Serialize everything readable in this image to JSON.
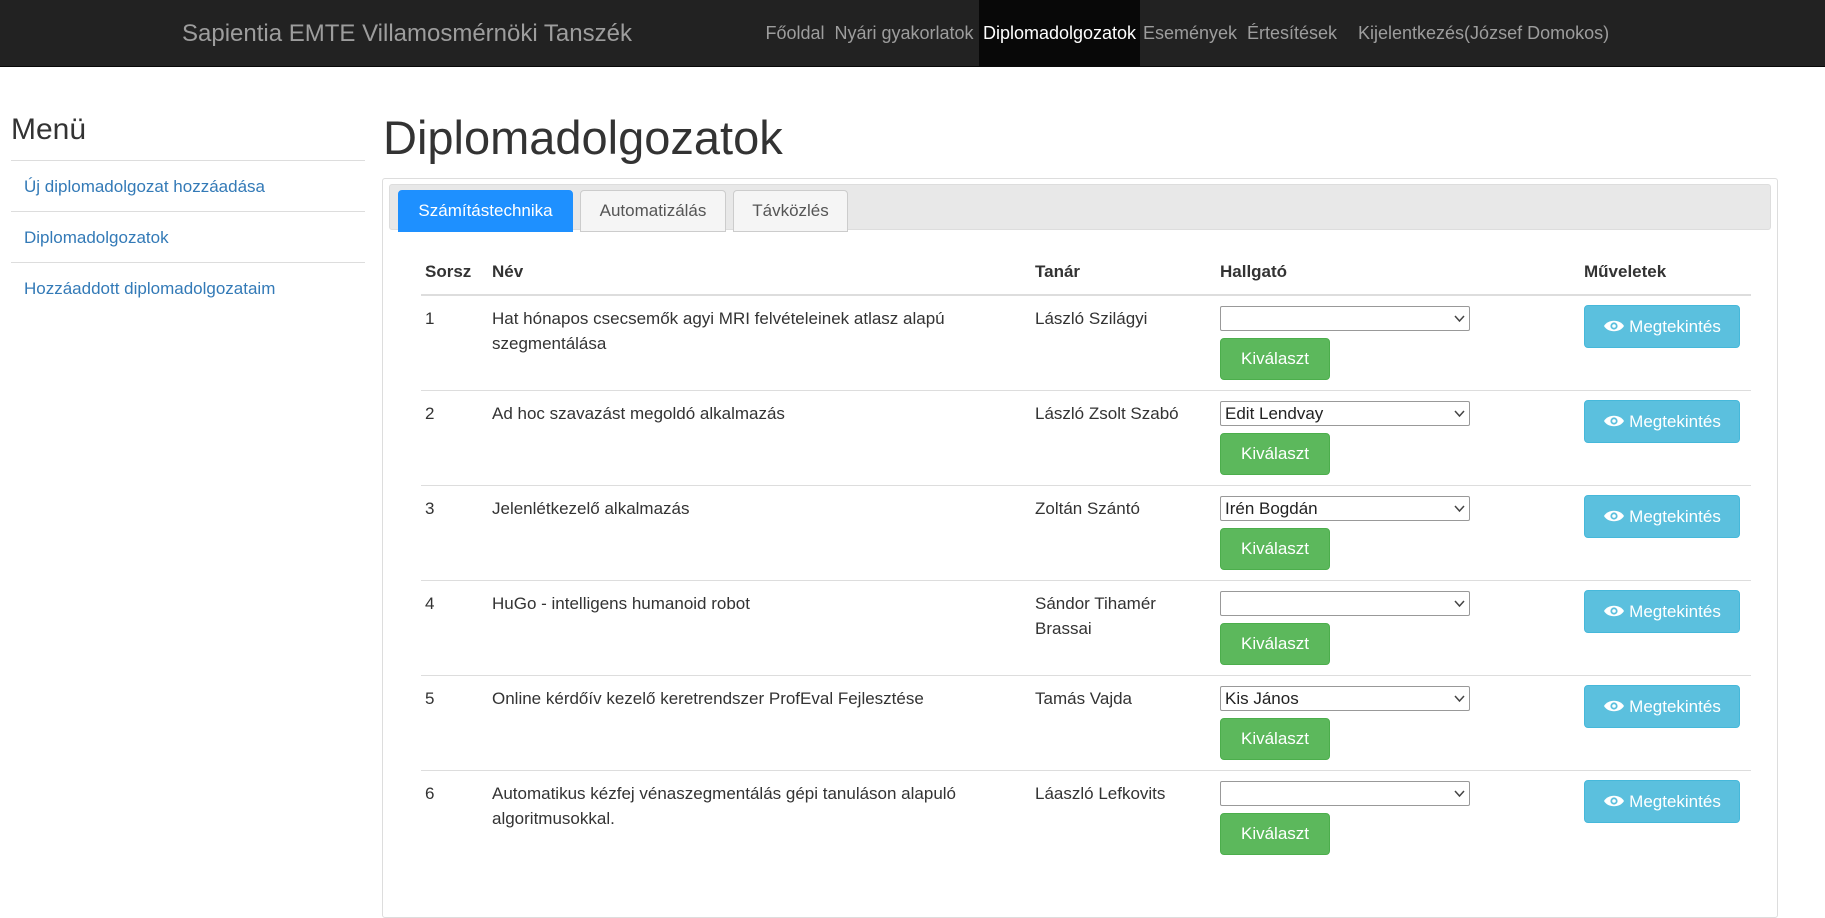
{
  "navbar": {
    "brand": "Sapientia EMTE Villamosmérnöki Tanszék",
    "items": [
      "Főoldal",
      "Nyári gyakorlatok",
      "Diplomadolgozatok",
      "Események",
      "Értesítések",
      "Kijelentkezés(József Domokos)"
    ],
    "active": "Diplomadolgozatok"
  },
  "sidebar": {
    "title": "Menü",
    "items": [
      "Új diplomadolgozat hozzáadása",
      "Diplomadolgozatok",
      "Hozzáaddott diplomadolgozataim"
    ]
  },
  "main": {
    "title": "Diplomadolgozatok",
    "tabs": [
      "Számítástechnika",
      "Automatizálás",
      "Távközlés"
    ],
    "active_tab": "Számítástechnika",
    "table": {
      "headers": [
        "Sorsz",
        "Név",
        "Tanár",
        "Hallgató",
        "Műveletek"
      ],
      "select_label": "Kiválaszt",
      "view_label": "Megtekintés",
      "rows": [
        {
          "num": "1",
          "name": "Hat hónapos csecsemők agyi MRI felvételeinek atlasz alapú szegmentálása",
          "teacher": "László Szilágyi",
          "student": ""
        },
        {
          "num": "2",
          "name": "Ad hoc szavazást megoldó alkalmazás",
          "teacher": "László Zsolt Szabó",
          "student": "Edit Lendvay"
        },
        {
          "num": "3",
          "name": "Jelenlétkezelő alkalmazás",
          "teacher": "Zoltán Szántó",
          "student": "Irén Bogdán"
        },
        {
          "num": "4",
          "name": "HuGo - intelligens humanoid robot",
          "teacher": "Sándor Tihamér Brassai",
          "student": ""
        },
        {
          "num": "5",
          "name": "Online kérdőív kezelő keretrendszer ProfEval Fejlesztése",
          "teacher": "Tamás Vajda",
          "student": "Kis János"
        },
        {
          "num": "6",
          "name": "Automatikus kézfej vénaszegmentálás gépi tanuláson alapuló algoritmusokkal.",
          "teacher": "Láaszló Lefkovits",
          "student": ""
        }
      ]
    }
  },
  "colors": {
    "navbar_bg": "#222222",
    "tab_active": "#1e90ff",
    "select_button": "#5cb85c",
    "view_button": "#5bc0de",
    "link": "#337ab7"
  },
  "icons": {
    "view": "eye-icon",
    "dropdown": "chevron-down-icon"
  }
}
